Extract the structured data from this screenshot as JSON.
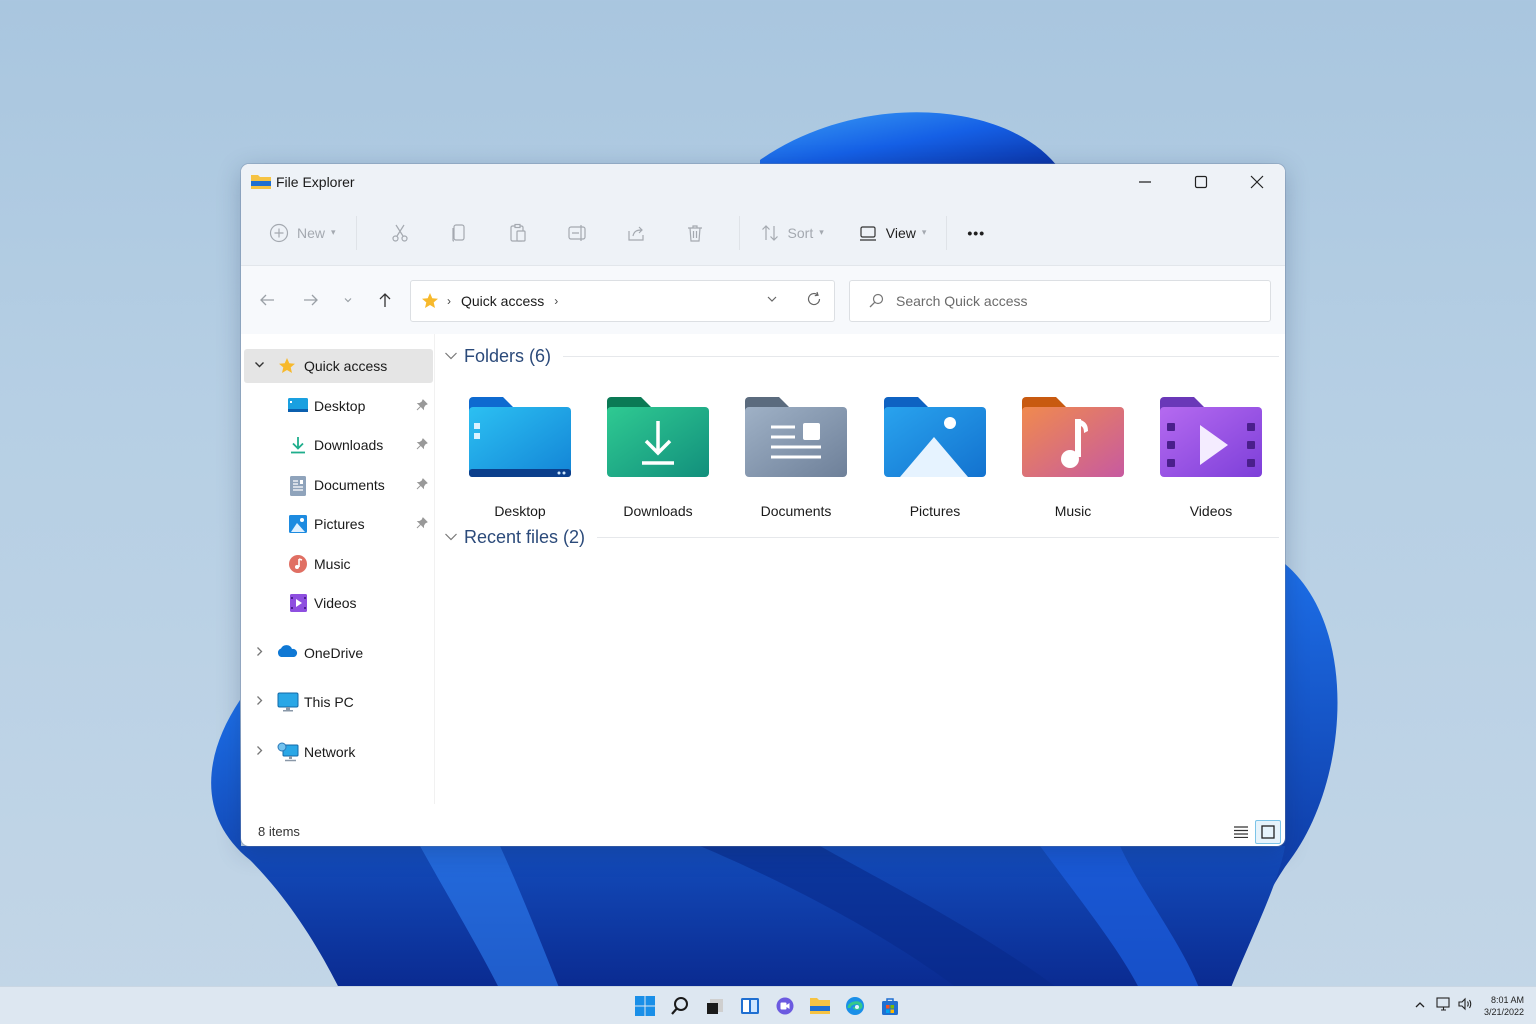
{
  "window": {
    "title": "File Explorer",
    "controls": {
      "minimize": "minimize-icon",
      "maximize": "maximize-icon",
      "close": "close-icon"
    }
  },
  "commandbar": {
    "new_label": "New",
    "sort_label": "Sort",
    "view_label": "View",
    "more_label": "•••",
    "icons": [
      "cut-icon",
      "copy-icon",
      "paste-icon",
      "rename-icon",
      "share-icon",
      "delete-icon"
    ]
  },
  "address": {
    "breadcrumb": [
      "Quick access"
    ],
    "root_icon": "star-icon"
  },
  "search": {
    "placeholder": "Search Quick access",
    "value": ""
  },
  "sidebar": {
    "items": [
      {
        "label": "Quick access",
        "icon": "star-icon",
        "expanded": true,
        "selected": true
      },
      {
        "label": "Desktop",
        "icon": "desktop-icon",
        "pinned": true
      },
      {
        "label": "Downloads",
        "icon": "download-icon",
        "pinned": true
      },
      {
        "label": "Documents",
        "icon": "documents-icon",
        "pinned": true
      },
      {
        "label": "Pictures",
        "icon": "pictures-icon",
        "pinned": true
      },
      {
        "label": "Music",
        "icon": "music-icon",
        "pinned": false
      },
      {
        "label": "Videos",
        "icon": "videos-icon",
        "pinned": false
      },
      {
        "label": "OneDrive",
        "icon": "onedrive-icon",
        "expanded": false
      },
      {
        "label": "This PC",
        "icon": "this-pc-icon",
        "expanded": false
      },
      {
        "label": "Network",
        "icon": "network-icon",
        "expanded": false
      }
    ]
  },
  "main": {
    "folders_header": "Folders (6)",
    "recent_header": "Recent files (2)",
    "folders": [
      {
        "name": "Desktop",
        "color": "#1aa0e0"
      },
      {
        "name": "Downloads",
        "color": "#1fae8c"
      },
      {
        "name": "Documents",
        "color": "#8a9db3"
      },
      {
        "name": "Pictures",
        "color": "#1d8be0"
      },
      {
        "name": "Music",
        "color": "#e9795e"
      },
      {
        "name": "Videos",
        "color": "#9b5ee6"
      }
    ]
  },
  "status": {
    "items": "8 items"
  },
  "taskbar": {
    "apps": [
      "start-icon",
      "search-icon",
      "task-view-icon",
      "widgets-icon",
      "chat-icon",
      "file-explorer-icon",
      "edge-icon",
      "store-icon"
    ],
    "time": "8:01 AM",
    "date": "3/21/2022"
  }
}
